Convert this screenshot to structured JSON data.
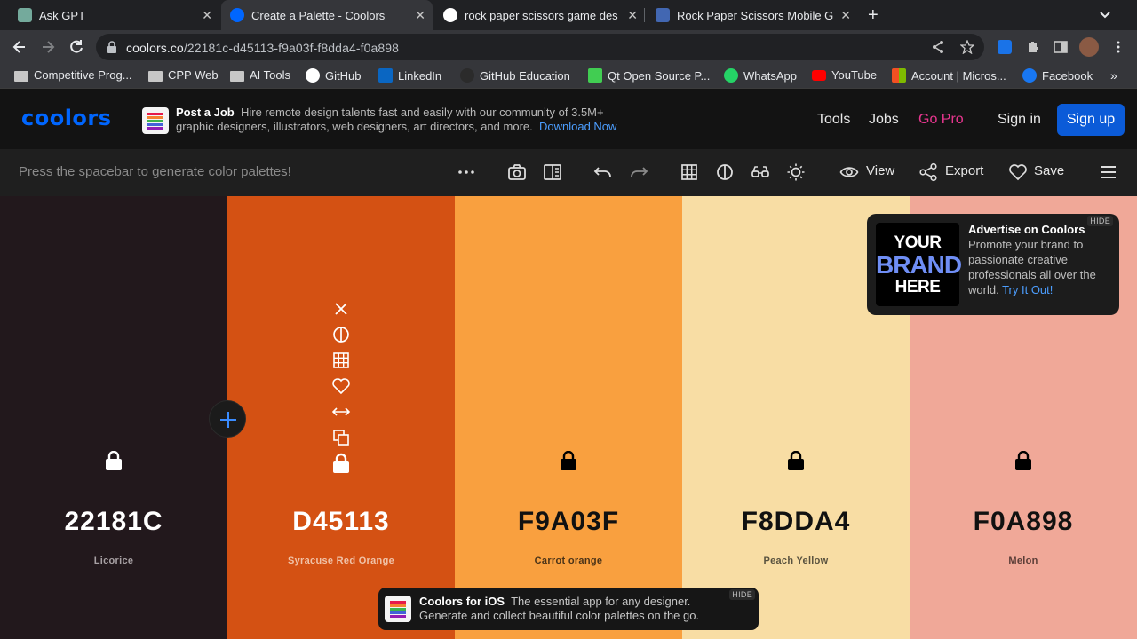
{
  "tabs": [
    {
      "title": "Ask GPT",
      "favicon": "chatgpt-icon",
      "active": false
    },
    {
      "title": "Create a Palette - Coolors",
      "favicon": "coolors-icon",
      "active": true
    },
    {
      "title": "rock paper scissors game des",
      "favicon": "google-icon",
      "active": false
    },
    {
      "title": "Rock Paper Scissors Mobile G",
      "favicon": "facebook-icon",
      "active": false
    }
  ],
  "address": {
    "host": "coolors.co",
    "path": "/22181c-d45113-f9a03f-f8dda4-f0a898"
  },
  "bookmarks": [
    {
      "label": "Competitive Prog..."
    },
    {
      "label": "CPP Web"
    },
    {
      "label": "AI Tools"
    },
    {
      "label": "GitHub"
    },
    {
      "label": "LinkedIn"
    },
    {
      "label": "GitHub Education"
    },
    {
      "label": "Qt Open Source P..."
    },
    {
      "label": "WhatsApp"
    },
    {
      "label": "YouTube"
    },
    {
      "label": "Account | Micros..."
    },
    {
      "label": "Facebook"
    }
  ],
  "header": {
    "logo": "coolors",
    "postjob_title": "Post a Job",
    "postjob_text": "Hire remote design talents fast and easily with our community of 3.5M+ graphic designers, illustrators, web designers, art directors, and more.",
    "postjob_link": "Download Now",
    "nav": {
      "tools": "Tools",
      "jobs": "Jobs",
      "gopro": "Go Pro",
      "signin": "Sign in",
      "signup": "Sign up"
    }
  },
  "toolbar": {
    "hint": "Press the spacebar to generate color palettes!",
    "view": "View",
    "export": "Export",
    "save": "Save"
  },
  "palette": [
    {
      "hex": "22181C",
      "name": "Licorice",
      "color": "#22181C",
      "text_color": "#ffffff",
      "name_color": "#a7a0a3"
    },
    {
      "hex": "D45113",
      "name": "Syracuse Red Orange",
      "color": "#D45113",
      "text_color": "#ffffff",
      "name_color": "#f0c3a9"
    },
    {
      "hex": "F9A03F",
      "name": "Carrot orange",
      "color": "#F9A03F",
      "text_color": "#111111",
      "name_color": "#4a3318"
    },
    {
      "hex": "F8DDA4",
      "name": "Peach Yellow",
      "color": "#F8DDA4",
      "text_color": "#111111",
      "name_color": "#59523f"
    },
    {
      "hex": "F0A898",
      "name": "Melon",
      "color": "#F0A898",
      "text_color": "#111111",
      "name_color": "#5a3d37"
    }
  ],
  "ad": {
    "img_line1": "YOUR",
    "img_line2": "BRAND",
    "img_line3": "HERE",
    "title": "Advertise on Coolors",
    "text": "Promote your brand to passionate creative professionals all over the world.",
    "link": "Try It Out!",
    "hide": "HIDE"
  },
  "ios": {
    "title": "Coolors for iOS",
    "text1": "The essential app for any designer.",
    "text2": "Generate and collect beautiful color palettes on the go.",
    "hide": "HIDE"
  }
}
